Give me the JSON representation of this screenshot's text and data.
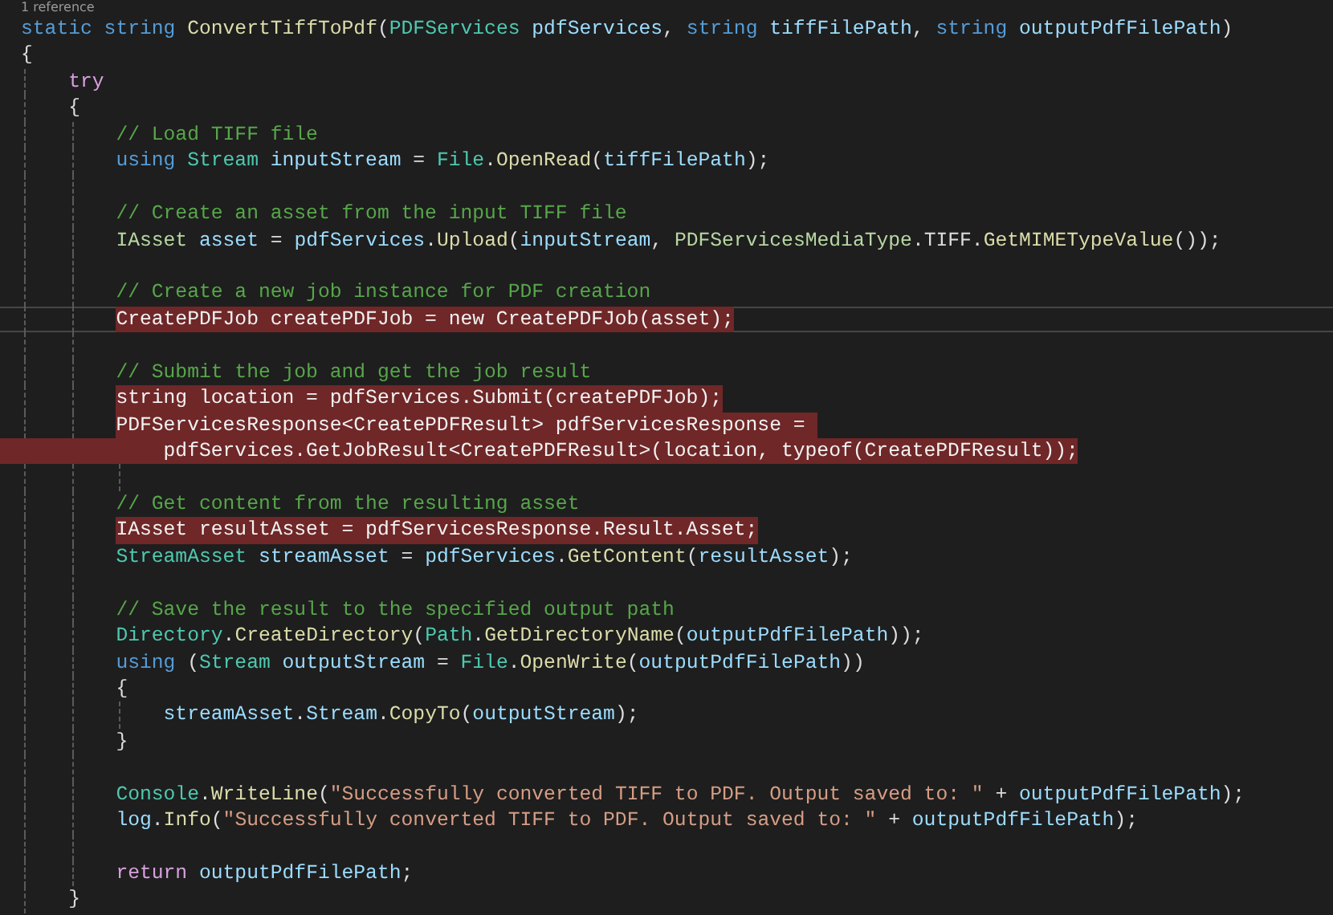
{
  "editor": {
    "codelens": "1 reference",
    "lines": [
      {
        "kind": "code",
        "highlighted": false,
        "current": false,
        "tokens": [
          {
            "text": "static ",
            "kind": "keyword"
          },
          {
            "text": "string ",
            "kind": "keyword"
          },
          {
            "text": "ConvertTiffToPdf",
            "kind": "method"
          },
          {
            "text": "(",
            "kind": "plain"
          },
          {
            "text": "PDFServices ",
            "kind": "type"
          },
          {
            "text": "pdfServices",
            "kind": "identifier"
          },
          {
            "text": ", ",
            "kind": "plain"
          },
          {
            "text": "string ",
            "kind": "keyword"
          },
          {
            "text": "tiffFilePath",
            "kind": "identifier"
          },
          {
            "text": ", ",
            "kind": "plain"
          },
          {
            "text": "string ",
            "kind": "keyword"
          },
          {
            "text": "outputPdfFilePath",
            "kind": "identifier"
          },
          {
            "text": ")",
            "kind": "plain"
          }
        ]
      },
      {
        "kind": "code",
        "highlighted": false,
        "current": false,
        "tokens": [
          {
            "text": "{",
            "kind": "plain"
          }
        ]
      },
      {
        "kind": "code",
        "highlighted": false,
        "current": false,
        "tokens": [
          {
            "text": "    try",
            "kind": "control"
          }
        ]
      },
      {
        "kind": "code",
        "highlighted": false,
        "current": false,
        "tokens": [
          {
            "text": "    {",
            "kind": "plain"
          }
        ]
      },
      {
        "kind": "code",
        "highlighted": false,
        "current": false,
        "tokens": [
          {
            "text": "        // Load TIFF file",
            "kind": "comment"
          }
        ]
      },
      {
        "kind": "code",
        "highlighted": false,
        "current": false,
        "tokens": [
          {
            "text": "        using ",
            "kind": "keyword"
          },
          {
            "text": "Stream ",
            "kind": "type"
          },
          {
            "text": "inputStream",
            "kind": "identifier"
          },
          {
            "text": " = ",
            "kind": "plain"
          },
          {
            "text": "File",
            "kind": "type"
          },
          {
            "text": ".",
            "kind": "plain"
          },
          {
            "text": "OpenRead",
            "kind": "method"
          },
          {
            "text": "(",
            "kind": "plain"
          },
          {
            "text": "tiffFilePath",
            "kind": "identifier"
          },
          {
            "text": ");",
            "kind": "plain"
          }
        ]
      },
      {
        "kind": "blank",
        "highlighted": false,
        "current": false
      },
      {
        "kind": "code",
        "highlighted": false,
        "current": false,
        "tokens": [
          {
            "text": "        // Create an asset from the input TIFF file",
            "kind": "comment"
          }
        ]
      },
      {
        "kind": "code",
        "highlighted": false,
        "current": false,
        "tokens": [
          {
            "text": "        IAsset ",
            "kind": "interface"
          },
          {
            "text": "asset",
            "kind": "identifier"
          },
          {
            "text": " = ",
            "kind": "plain"
          },
          {
            "text": "pdfServices",
            "kind": "identifier"
          },
          {
            "text": ".",
            "kind": "plain"
          },
          {
            "text": "Upload",
            "kind": "method"
          },
          {
            "text": "(",
            "kind": "plain"
          },
          {
            "text": "inputStream",
            "kind": "identifier"
          },
          {
            "text": ", ",
            "kind": "plain"
          },
          {
            "text": "PDFServicesMediaType",
            "kind": "interface"
          },
          {
            "text": ".TIFF.",
            "kind": "plain"
          },
          {
            "text": "GetMIMETypeValue",
            "kind": "method"
          },
          {
            "text": "());",
            "kind": "plain"
          }
        ]
      },
      {
        "kind": "blank",
        "highlighted": false,
        "current": false
      },
      {
        "kind": "code",
        "highlighted": false,
        "current": false,
        "tokens": [
          {
            "text": "        // Create a new job instance for PDF creation",
            "kind": "comment"
          }
        ]
      },
      {
        "kind": "code",
        "highlighted": true,
        "current": true,
        "tokens": [
          {
            "text": "        CreatePDFJob createPDFJob = new CreatePDFJob(asset);",
            "kind": "plain"
          }
        ]
      },
      {
        "kind": "blank",
        "highlighted": false,
        "current": false
      },
      {
        "kind": "code",
        "highlighted": false,
        "current": false,
        "tokens": [
          {
            "text": "        // Submit the job and get the job result",
            "kind": "comment"
          }
        ]
      },
      {
        "kind": "code",
        "highlighted": true,
        "current": false,
        "tokens": [
          {
            "text": "        string location = pdfServices.Submit(createPDFJob);",
            "kind": "plain"
          }
        ]
      },
      {
        "kind": "code",
        "highlighted": true,
        "current": false,
        "tokens": [
          {
            "text": "        PDFServicesResponse<CreatePDFResult> pdfServicesResponse = ",
            "kind": "plain"
          }
        ]
      },
      {
        "kind": "continuation",
        "highlighted": true,
        "current": false,
        "tokens": [
          {
            "text": "            pdfServices.GetJobResult<CreatePDFResult>(location, typeof(CreatePDFResult));",
            "kind": "plain"
          }
        ]
      },
      {
        "kind": "blank",
        "highlighted": false,
        "current": false
      },
      {
        "kind": "code",
        "highlighted": false,
        "current": false,
        "tokens": [
          {
            "text": "        // Get content from the resulting asset",
            "kind": "comment"
          }
        ]
      },
      {
        "kind": "code",
        "highlighted": true,
        "current": false,
        "tokens": [
          {
            "text": "        IAsset resultAsset = pdfServicesResponse.Result.Asset;",
            "kind": "plain"
          }
        ]
      },
      {
        "kind": "code",
        "highlighted": false,
        "current": false,
        "tokens": [
          {
            "text": "        StreamAsset ",
            "kind": "type"
          },
          {
            "text": "streamAsset",
            "kind": "identifier"
          },
          {
            "text": " = ",
            "kind": "plain"
          },
          {
            "text": "pdfServices",
            "kind": "identifier"
          },
          {
            "text": ".",
            "kind": "plain"
          },
          {
            "text": "GetContent",
            "kind": "method"
          },
          {
            "text": "(",
            "kind": "plain"
          },
          {
            "text": "resultAsset",
            "kind": "identifier"
          },
          {
            "text": ");",
            "kind": "plain"
          }
        ]
      },
      {
        "kind": "blank",
        "highlighted": false,
        "current": false
      },
      {
        "kind": "code",
        "highlighted": false,
        "current": false,
        "tokens": [
          {
            "text": "        // Save the result to the specified output path",
            "kind": "comment"
          }
        ]
      },
      {
        "kind": "code",
        "highlighted": false,
        "current": false,
        "tokens": [
          {
            "text": "        Directory",
            "kind": "type"
          },
          {
            "text": ".",
            "kind": "plain"
          },
          {
            "text": "CreateDirectory",
            "kind": "method"
          },
          {
            "text": "(",
            "kind": "plain"
          },
          {
            "text": "Path",
            "kind": "type"
          },
          {
            "text": ".",
            "kind": "plain"
          },
          {
            "text": "GetDirectoryName",
            "kind": "method"
          },
          {
            "text": "(",
            "kind": "plain"
          },
          {
            "text": "outputPdfFilePath",
            "kind": "identifier"
          },
          {
            "text": "));",
            "kind": "plain"
          }
        ]
      },
      {
        "kind": "code",
        "highlighted": false,
        "current": false,
        "tokens": [
          {
            "text": "        using ",
            "kind": "keyword"
          },
          {
            "text": "(",
            "kind": "plain"
          },
          {
            "text": "Stream ",
            "kind": "type"
          },
          {
            "text": "outputStream",
            "kind": "identifier"
          },
          {
            "text": " = ",
            "kind": "plain"
          },
          {
            "text": "File",
            "kind": "type"
          },
          {
            "text": ".",
            "kind": "plain"
          },
          {
            "text": "OpenWrite",
            "kind": "method"
          },
          {
            "text": "(",
            "kind": "plain"
          },
          {
            "text": "outputPdfFilePath",
            "kind": "identifier"
          },
          {
            "text": "))",
            "kind": "plain"
          }
        ]
      },
      {
        "kind": "code",
        "highlighted": false,
        "current": false,
        "tokens": [
          {
            "text": "        {",
            "kind": "plain"
          }
        ]
      },
      {
        "kind": "code",
        "highlighted": false,
        "current": false,
        "tokens": [
          {
            "text": "            streamAsset",
            "kind": "identifier"
          },
          {
            "text": ".",
            "kind": "plain"
          },
          {
            "text": "Stream",
            "kind": "identifier"
          },
          {
            "text": ".",
            "kind": "plain"
          },
          {
            "text": "CopyTo",
            "kind": "method"
          },
          {
            "text": "(",
            "kind": "plain"
          },
          {
            "text": "outputStream",
            "kind": "identifier"
          },
          {
            "text": ");",
            "kind": "plain"
          }
        ]
      },
      {
        "kind": "code",
        "highlighted": false,
        "current": false,
        "tokens": [
          {
            "text": "        }",
            "kind": "plain"
          }
        ]
      },
      {
        "kind": "blank",
        "highlighted": false,
        "current": false
      },
      {
        "kind": "code",
        "highlighted": false,
        "current": false,
        "tokens": [
          {
            "text": "        Console",
            "kind": "type"
          },
          {
            "text": ".",
            "kind": "plain"
          },
          {
            "text": "WriteLine",
            "kind": "method"
          },
          {
            "text": "(",
            "kind": "plain"
          },
          {
            "text": "\"Successfully converted TIFF to PDF. Output saved to: \"",
            "kind": "string"
          },
          {
            "text": " + ",
            "kind": "plain"
          },
          {
            "text": "outputPdfFilePath",
            "kind": "identifier"
          },
          {
            "text": ");",
            "kind": "plain"
          }
        ]
      },
      {
        "kind": "code",
        "highlighted": false,
        "current": false,
        "tokens": [
          {
            "text": "        log",
            "kind": "identifier"
          },
          {
            "text": ".",
            "kind": "plain"
          },
          {
            "text": "Info",
            "kind": "method"
          },
          {
            "text": "(",
            "kind": "plain"
          },
          {
            "text": "\"Successfully converted TIFF to PDF. Output saved to: \"",
            "kind": "string"
          },
          {
            "text": " + ",
            "kind": "plain"
          },
          {
            "text": "outputPdfFilePath",
            "kind": "identifier"
          },
          {
            "text": ");",
            "kind": "plain"
          }
        ]
      },
      {
        "kind": "blank",
        "highlighted": false,
        "current": false
      },
      {
        "kind": "code",
        "highlighted": false,
        "current": false,
        "tokens": [
          {
            "text": "        return ",
            "kind": "control"
          },
          {
            "text": "outputPdfFilePath",
            "kind": "identifier"
          },
          {
            "text": ";",
            "kind": "plain"
          }
        ]
      },
      {
        "kind": "code",
        "highlighted": false,
        "current": false,
        "tokens": [
          {
            "text": "    }",
            "kind": "plain"
          }
        ]
      }
    ]
  }
}
